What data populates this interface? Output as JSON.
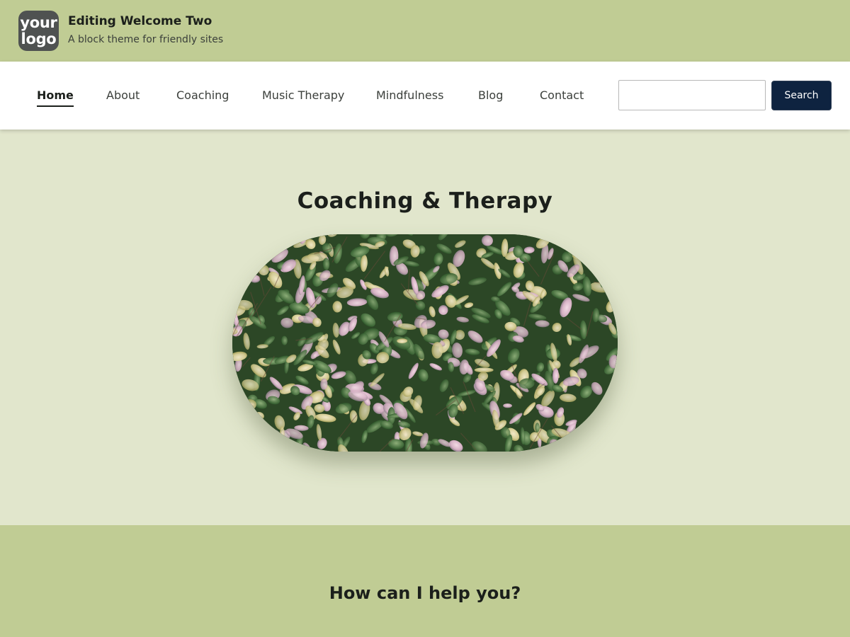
{
  "header": {
    "logo_line1": "your",
    "logo_line2": "logo",
    "site_title": "Editing Welcome Two",
    "tagline": "A block theme for friendly sites"
  },
  "nav": {
    "items": [
      {
        "label": "Home",
        "active": true
      },
      {
        "label": "About"
      },
      {
        "label": "Coaching"
      },
      {
        "label": "Music Therapy"
      },
      {
        "label": "Mindfulness"
      },
      {
        "label": "Blog"
      },
      {
        "label": "Contact"
      }
    ],
    "search_value": "",
    "search_button": "Search"
  },
  "hero": {
    "title": "Coaching & Therapy",
    "image": "variegated-foliage-photo"
  },
  "help": {
    "title": "How can I help you?"
  },
  "colors": {
    "header_bg": "#c0cc94",
    "hero_bg": "#e1e6cc",
    "nav_bg": "#ffffff",
    "button_bg": "#0e2340",
    "logo_bg": "#4f5251"
  }
}
